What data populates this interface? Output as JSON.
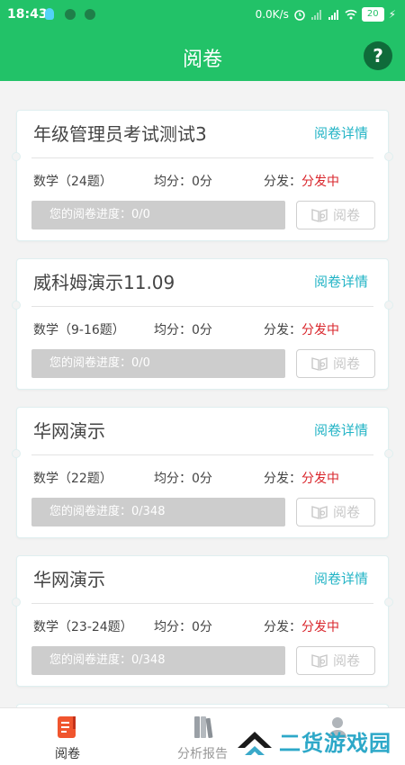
{
  "status_bar": {
    "time": "18:43",
    "net_speed": "0.0K/s",
    "battery": "20"
  },
  "header": {
    "title": "阅卷",
    "help_label": "?"
  },
  "cards": [
    {
      "title": "年级管理员考试测试3",
      "detail_link": "阅卷详情",
      "subject": "数学（24题）",
      "average": "均分：0分",
      "distribute_label": "分发：",
      "distribute_status": "分发中",
      "progress": "您的阅卷进度：0/0",
      "grade_button": "阅卷"
    },
    {
      "title": "威科姆演示11.09",
      "detail_link": "阅卷详情",
      "subject": "数学（9-16题）",
      "average": "均分：0分",
      "distribute_label": "分发：",
      "distribute_status": "分发中",
      "progress": "您的阅卷进度：0/0",
      "grade_button": "阅卷"
    },
    {
      "title": "华网演示",
      "detail_link": "阅卷详情",
      "subject": "数学（22题）",
      "average": "均分：0分",
      "distribute_label": "分发：",
      "distribute_status": "分发中",
      "progress": "您的阅卷进度：0/348",
      "grade_button": "阅卷"
    },
    {
      "title": "华网演示",
      "detail_link": "阅卷详情",
      "subject": "数学（23-24题）",
      "average": "均分：0分",
      "distribute_label": "分发：",
      "distribute_status": "分发中",
      "progress": "您的阅卷进度：0/348",
      "grade_button": "阅卷"
    }
  ],
  "tabbar": {
    "tabs": [
      {
        "label": "阅卷",
        "icon": "grading-icon",
        "active": true
      },
      {
        "label": "分析报告",
        "icon": "report-books-icon",
        "active": false
      },
      {
        "label": "",
        "icon": "profile-icon",
        "active": false
      }
    ]
  },
  "watermark": {
    "text": "二货游戏园"
  },
  "colors": {
    "primary": "#22c268",
    "detail": "#23b4c6",
    "status_red": "#d9252b",
    "progress_bg": "#cdcdcd"
  }
}
